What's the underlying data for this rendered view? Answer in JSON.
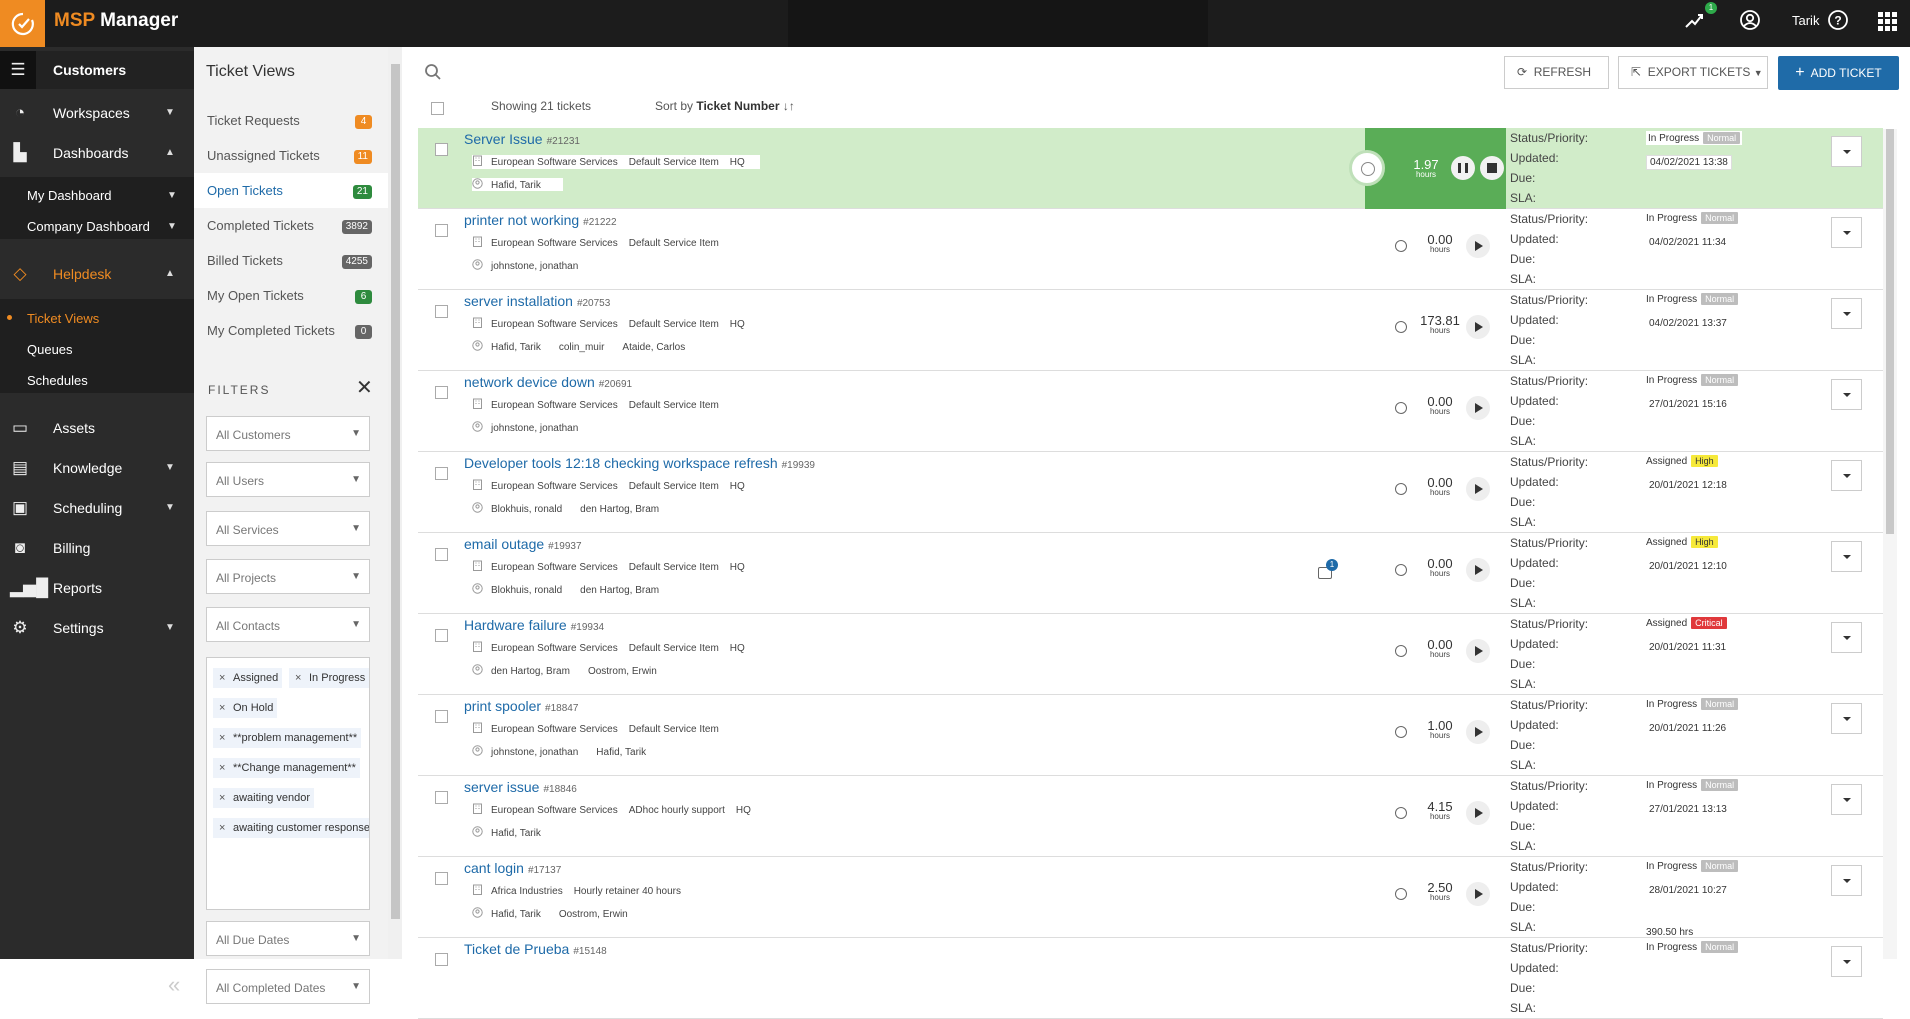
{
  "app": {
    "brand_prefix": "MSP",
    "brand_suffix": " Manager",
    "user": "Tarik",
    "notification_count": "1"
  },
  "sidebar": {
    "items": [
      {
        "label": "Customers",
        "icon": "list-icon"
      },
      {
        "label": "Workspaces",
        "icon": "gauge-icon"
      },
      {
        "label": "Dashboards",
        "icon": "bar-chart-icon"
      },
      {
        "label": "My Dashboard"
      },
      {
        "label": "Company Dashboard"
      },
      {
        "label": "Helpdesk",
        "icon": "ticket-icon"
      },
      {
        "label": "Ticket Views"
      },
      {
        "label": "Queues"
      },
      {
        "label": "Schedules"
      },
      {
        "label": "Assets",
        "icon": "monitor-icon"
      },
      {
        "label": "Knowledge",
        "icon": "book-icon"
      },
      {
        "label": "Scheduling",
        "icon": "calendar-clock-icon"
      },
      {
        "label": "Billing",
        "icon": "money-icon"
      },
      {
        "label": "Reports",
        "icon": "reports-icon"
      },
      {
        "label": "Settings",
        "icon": "gear-icon"
      }
    ]
  },
  "ticket_views": {
    "title": "Ticket Views",
    "items": [
      {
        "label": "Ticket Requests",
        "count": "4",
        "color": "#ef8b22"
      },
      {
        "label": "Unassigned Tickets",
        "count": "11",
        "color": "#ef8b22"
      },
      {
        "label": "Open Tickets",
        "count": "21",
        "color": "#2e8b3e"
      },
      {
        "label": "Completed Tickets",
        "count": "3892",
        "color": "#666666"
      },
      {
        "label": "Billed Tickets",
        "count": "4255",
        "color": "#666666"
      },
      {
        "label": "My Open Tickets",
        "count": "6",
        "color": "#2e8b3e"
      },
      {
        "label": "My Completed Tickets",
        "count": "0",
        "color": "#666666"
      }
    ],
    "filters_label": "FILTERS",
    "selects": [
      "All Customers",
      "All Users",
      "All Services",
      "All Projects",
      "All Contacts"
    ],
    "status_tags": [
      "Assigned",
      "In Progress",
      "On Hold",
      "**problem management**",
      "**Change management**",
      "awaiting vendor",
      "awaiting customer response"
    ],
    "date_selects": [
      "All Due Dates",
      "All Completed Dates"
    ]
  },
  "toolbar": {
    "refresh": "REFRESH",
    "export": "EXPORT TICKETS",
    "add": "ADD TICKET"
  },
  "list": {
    "showing": "Showing 21 tickets",
    "sort_prefix": "Sort by ",
    "sort_field": "Ticket Number",
    "labels": {
      "status": "Status/Priority:",
      "updated": "Updated:",
      "due": "Due:",
      "sla": "SLA:"
    },
    "hours_unit": "hours"
  },
  "tickets": [
    {
      "title": "Server Issue",
      "num": "#21231",
      "meta": [
        "European Software Services",
        "Default Service Item",
        "HQ"
      ],
      "people": [
        "Hafid, Tarik"
      ],
      "hours": "1.97",
      "status": "In Progress",
      "priority": "Normal",
      "updated": "04/02/2021 13:38",
      "active": true
    },
    {
      "title": "printer not working",
      "num": "#21222",
      "meta": [
        "European Software Services",
        "Default Service Item"
      ],
      "people": [
        "johnstone, jonathan"
      ],
      "hours": "0.00",
      "status": "In Progress",
      "priority": "Normal",
      "updated": "04/02/2021 11:34"
    },
    {
      "title": "server installation",
      "num": "#20753",
      "meta": [
        "European Software Services",
        "Default Service Item",
        "HQ"
      ],
      "people": [
        "Hafid, Tarik",
        "colin_muir",
        "Ataide, Carlos"
      ],
      "hours": "173.81",
      "status": "In Progress",
      "priority": "Normal",
      "updated": "04/02/2021 13:37"
    },
    {
      "title": "network device down",
      "num": "#20691",
      "meta": [
        "European Software Services",
        "Default Service Item"
      ],
      "people": [
        "johnstone, jonathan"
      ],
      "hours": "0.00",
      "status": "In Progress",
      "priority": "Normal",
      "updated": "27/01/2021 15:16"
    },
    {
      "title": "Developer tools 12:18 checking workspace refresh",
      "num": "#19939",
      "meta": [
        "European Software Services",
        "Default Service Item",
        "HQ"
      ],
      "people": [
        "Blokhuis, ronald",
        "den Hartog, Bram"
      ],
      "hours": "0.00",
      "status": "Assigned",
      "priority": "High",
      "updated": "20/01/2021 12:18"
    },
    {
      "title": "email outage",
      "num": "#19937",
      "meta": [
        "European Software Services",
        "Default Service Item",
        "HQ"
      ],
      "people": [
        "Blokhuis, ronald",
        "den Hartog, Bram"
      ],
      "hours": "0.00",
      "status": "Assigned",
      "priority": "High",
      "updated": "20/01/2021 12:10",
      "comments": "1"
    },
    {
      "title": "Hardware failure",
      "num": "#19934",
      "meta": [
        "European Software Services",
        "Default Service Item",
        "HQ"
      ],
      "people": [
        "den Hartog, Bram",
        "Oostrom, Erwin"
      ],
      "hours": "0.00",
      "status": "Assigned",
      "priority": "Critical",
      "updated": "20/01/2021 11:31"
    },
    {
      "title": "print spooler",
      "num": "#18847",
      "meta": [
        "European Software Services",
        "Default Service Item"
      ],
      "people": [
        "johnstone, jonathan",
        "Hafid, Tarik"
      ],
      "hours": "1.00",
      "status": "In Progress",
      "priority": "Normal",
      "updated": "20/01/2021 11:26"
    },
    {
      "title": "server issue",
      "num": "#18846",
      "meta": [
        "European Software Services",
        "ADhoc hourly support",
        "HQ"
      ],
      "people": [
        "Hafid, Tarik"
      ],
      "hours": "4.15",
      "status": "In Progress",
      "priority": "Normal",
      "updated": "27/01/2021 13:13"
    },
    {
      "title": "cant login",
      "num": "#17137",
      "meta": [
        "Africa Industries",
        "Hourly retainer 40 hours"
      ],
      "people": [
        "Hafid, Tarik",
        "Oostrom, Erwin"
      ],
      "hours": "2.50",
      "status": "In Progress",
      "priority": "Normal",
      "updated": "28/01/2021 10:27",
      "extra": "390.50 hrs"
    },
    {
      "title": "Ticket de Prueba",
      "num": "#15148",
      "meta": [],
      "people": [],
      "hours": "",
      "status": "In Progress",
      "priority": "Normal",
      "updated": ""
    }
  ]
}
